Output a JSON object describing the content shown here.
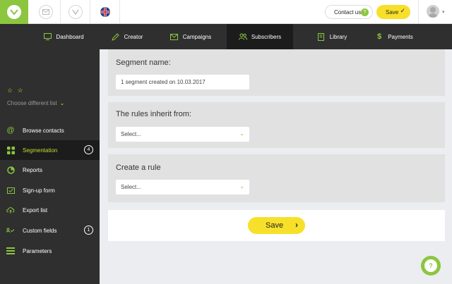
{
  "brand": {
    "accent": "#8cc63f",
    "yellow": "#f7e02a",
    "dark": "#2f2f2f"
  },
  "topbar": {
    "icons": [
      "logo-icon",
      "envelope-icon",
      "heart-icon",
      "uk-flag-icon"
    ],
    "contact_label": "Contact us",
    "contact_badge": "?",
    "save_label": "Save",
    "save_icon": "✓"
  },
  "nav": {
    "items": [
      {
        "label": "Dashboard",
        "icon": "monitor-icon"
      },
      {
        "label": "Creator",
        "icon": "pencil-icon"
      },
      {
        "label": "Campaigns",
        "icon": "envelope-icon"
      },
      {
        "label": "Subscribers",
        "icon": "people-icon",
        "active": true
      },
      {
        "label": "Library",
        "icon": "book-icon"
      },
      {
        "label": "Payments",
        "icon": "dollar-icon"
      }
    ]
  },
  "sidebar": {
    "stars": "☆ ☆",
    "choose_list": "Choose different list",
    "items": [
      {
        "label": "Browse contacts",
        "icon": "at-icon"
      },
      {
        "label": "Segmentation",
        "icon": "grid-icon",
        "badge": "4",
        "active": true
      },
      {
        "label": "Reports",
        "icon": "pie-icon"
      },
      {
        "label": "Sign-up form",
        "icon": "form-icon"
      },
      {
        "label": "Export list",
        "icon": "upload-icon"
      },
      {
        "label": "Custom fields",
        "icon": "fields-icon",
        "badge": "1"
      },
      {
        "label": "Parameters",
        "icon": "menu-icon"
      }
    ]
  },
  "main": {
    "segment_name_label": "Segment name:",
    "segment_name_value": "1 segment created on 10.03.2017",
    "inherit_label": "The rules inherit from:",
    "inherit_value": "Select...",
    "rule_label": "Create a rule",
    "rule_value": "Select...",
    "save_label": "Save",
    "save_icon": "›"
  },
  "help_label": "?"
}
